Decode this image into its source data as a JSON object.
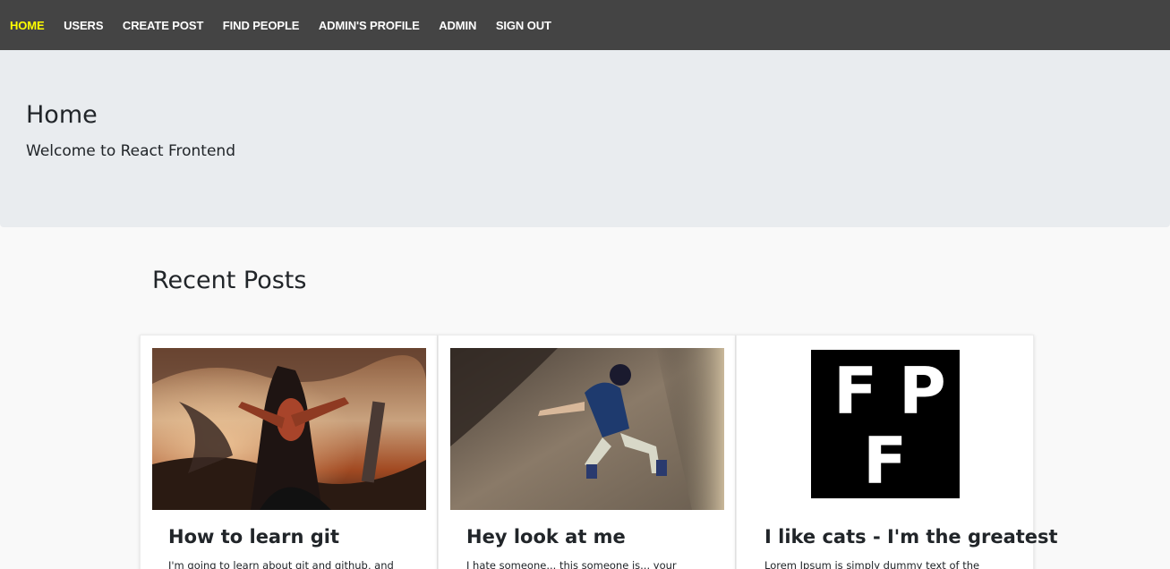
{
  "nav": {
    "items": [
      {
        "label": "HOME",
        "active": true
      },
      {
        "label": "USERS",
        "active": false
      },
      {
        "label": "CREATE POST",
        "active": false
      },
      {
        "label": "FIND PEOPLE",
        "active": false
      },
      {
        "label": "ADMIN'S PROFILE",
        "active": false
      },
      {
        "label": "ADMIN",
        "active": false
      },
      {
        "label": "SIGN OUT",
        "active": false
      }
    ],
    "active_color": "#ffff00",
    "background": "#444444"
  },
  "jumbotron": {
    "title": "Home",
    "lead": "Welcome to React Frontend"
  },
  "recent_posts": {
    "heading": "Recent Posts",
    "posts": [
      {
        "title": "How to learn git",
        "excerpt": "I'm going to learn about git and github, and",
        "image": "fantasy-warrior-painting"
      },
      {
        "title": "Hey look at me",
        "excerpt": "I hate someone... this someone is... your",
        "image": "climbing-figurine-photo"
      },
      {
        "title": "I like cats - I'm the greatest",
        "excerpt": "Lorem Ipsum is simply dummy text of the",
        "image": "fpf-logo",
        "logo_letters": [
          "F",
          "P",
          "F"
        ]
      }
    ]
  }
}
